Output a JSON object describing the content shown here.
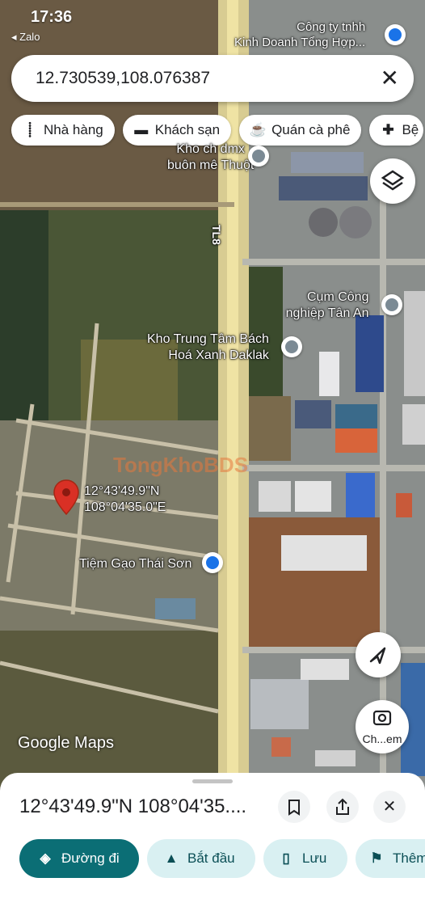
{
  "status_bar": {
    "time": "17:36",
    "back_app": "Zalo"
  },
  "search": {
    "query": "12.730539,108.076387"
  },
  "chips": [
    {
      "label": "Nhà hàng",
      "icon": "fork-knife-icon",
      "glyph": "⸽"
    },
    {
      "label": "Khách sạn",
      "icon": "bed-icon",
      "glyph": "▬"
    },
    {
      "label": "Quán cà phê",
      "icon": "coffee-icon",
      "glyph": "☕"
    },
    {
      "label": "Bệ",
      "icon": "hospital-icon",
      "glyph": "✚"
    }
  ],
  "map": {
    "road_label": "TL8",
    "pin_coords_line1": "12°43'49.9\"N",
    "pin_coords_line2": "108°04'35.0\"E",
    "watermark": "TongKhoBDS",
    "attribution": "Google Maps",
    "pois": {
      "top_line1": "Công ty tnhh",
      "top_line2": "Kinh Doanh Tổng Hợp...",
      "dmx_line1": "Kho ch dmx",
      "dmx_line2": "buôn mê Thuột",
      "cum_line1": "Cụm Công",
      "cum_line2": "nghiệp Tân An",
      "kho_line1": "Kho Trung Tâm Bách",
      "kho_line2": "Hoá Xanh Daklak",
      "gao": "Tiệm Gạo Thái Sơn"
    },
    "fab_search_label": "Ch...em"
  },
  "sheet": {
    "title": "12°43'49.9\"N 108°04'35....",
    "actions": [
      {
        "label": "Đường đi",
        "icon": "directions-icon"
      },
      {
        "label": "Bắt đầu",
        "icon": "navigation-arrow-icon"
      },
      {
        "label": "Lưu",
        "icon": "bookmark-icon"
      },
      {
        "label": "Thêm",
        "icon": "flag-icon"
      }
    ]
  },
  "colors": {
    "accent": "#0b6e75",
    "pin": "#d93025",
    "poi_blue": "#1a73e8"
  }
}
